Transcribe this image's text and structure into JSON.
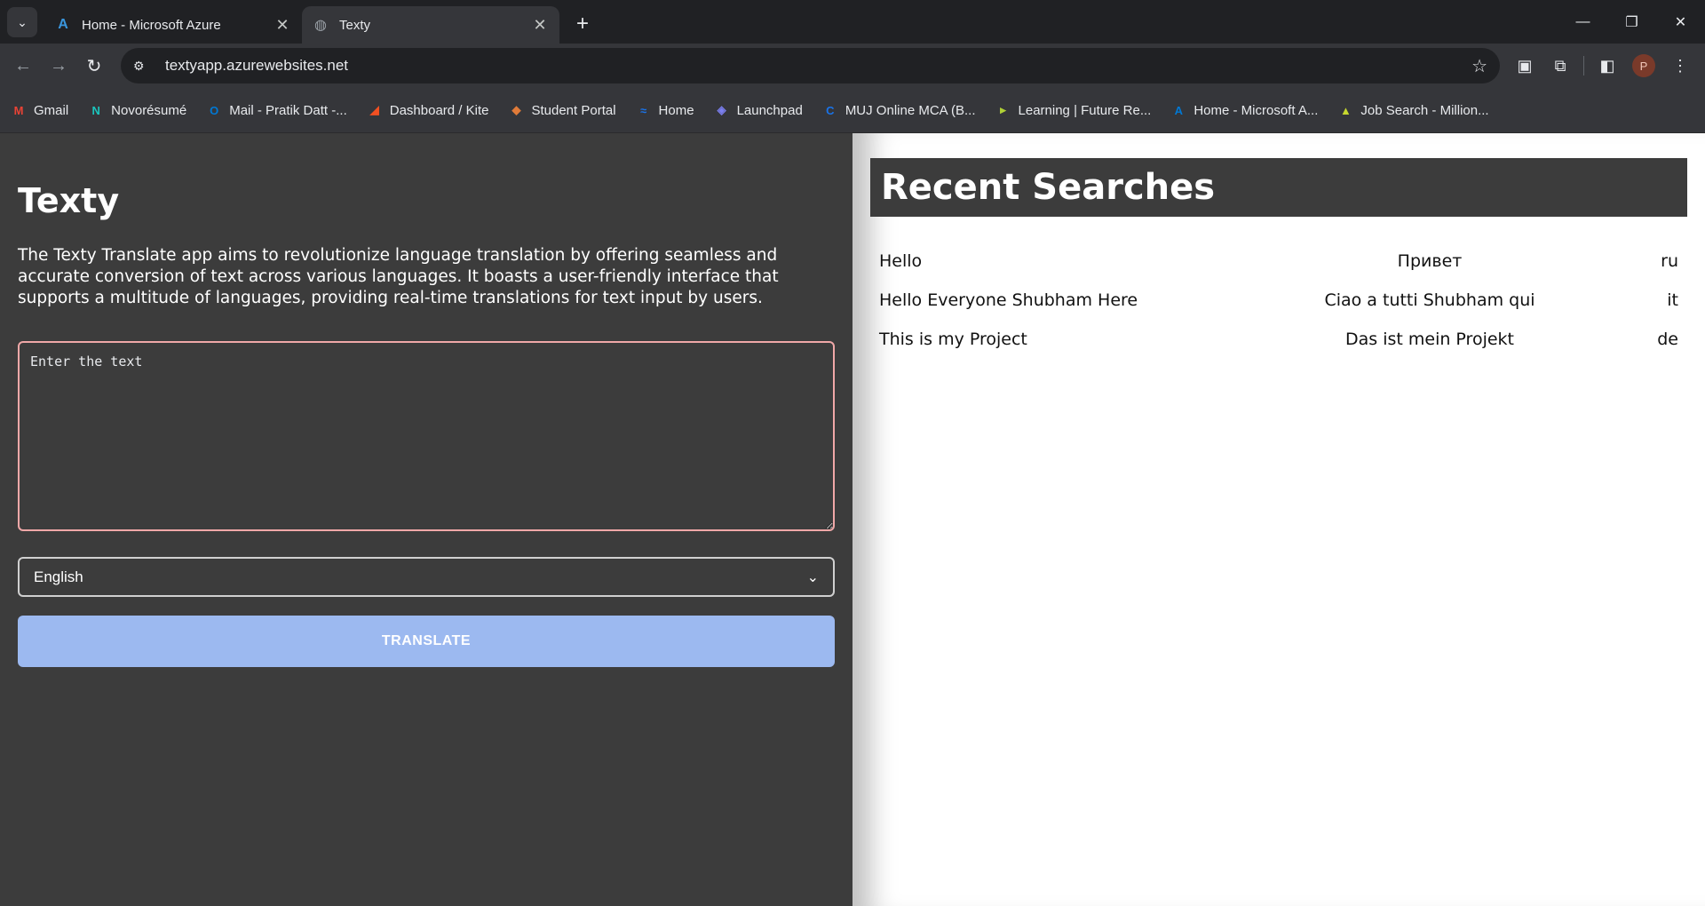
{
  "browser": {
    "tabs": [
      {
        "title": "Home - Microsoft Azure",
        "icon": "azure-icon",
        "active": false
      },
      {
        "title": "Texty",
        "icon": "globe-icon",
        "active": true
      }
    ],
    "url": "textyapp.azurewebsites.net",
    "profile_initial": "P"
  },
  "bookmarks": [
    {
      "label": "Gmail",
      "icon": "gmail-icon",
      "color": "#ea4335"
    },
    {
      "label": "Novorésumé",
      "icon": "novoresume-icon",
      "color": "#1bc5bd"
    },
    {
      "label": "Mail - Pratik Datt -...",
      "icon": "outlook-icon",
      "color": "#0078d4"
    },
    {
      "label": "Dashboard / Kite",
      "icon": "kite-icon",
      "color": "#f25022"
    },
    {
      "label": "Student Portal",
      "icon": "student-portal-icon",
      "color": "#e07b39"
    },
    {
      "label": "Home",
      "icon": "home-wave-icon",
      "color": "#1a73e8"
    },
    {
      "label": "Launchpad",
      "icon": "launchpad-icon",
      "color": "#7b7ff0"
    },
    {
      "label": "MUJ Online MCA (B...",
      "icon": "muj-icon",
      "color": "#1a73e8"
    },
    {
      "label": "Learning | Future Re...",
      "icon": "learning-icon",
      "color": "#b0d136"
    },
    {
      "label": "Home - Microsoft A...",
      "icon": "azure-icon",
      "color": "#0078d4"
    },
    {
      "label": "Job Search - Million...",
      "icon": "job-search-icon",
      "color": "#c7d82f"
    }
  ],
  "app": {
    "title": "Texty",
    "description": "The Texty Translate app aims to revolutionize language translation by offering seamless and accurate conversion of text across various languages. It boasts a user-friendly interface that supports a multitude of languages, providing real-time translations for text input by users.",
    "input_placeholder": "Enter the text",
    "selected_language": "English",
    "translate_label": "TRANSLATE"
  },
  "recent": {
    "heading": "Recent Searches",
    "items": [
      {
        "source": "Hello",
        "translation": "Привет",
        "lang": "ru"
      },
      {
        "source": "Hello Everyone Shubham Here",
        "translation": "Ciao a tutti Shubham qui",
        "lang": "it"
      },
      {
        "source": "This is my Project",
        "translation": "Das ist mein Projekt",
        "lang": "de"
      }
    ]
  },
  "colors": {
    "panel_dark": "#3c3c3c",
    "input_border": "#f0a8a8",
    "translate_button": "#9cb9f0"
  }
}
